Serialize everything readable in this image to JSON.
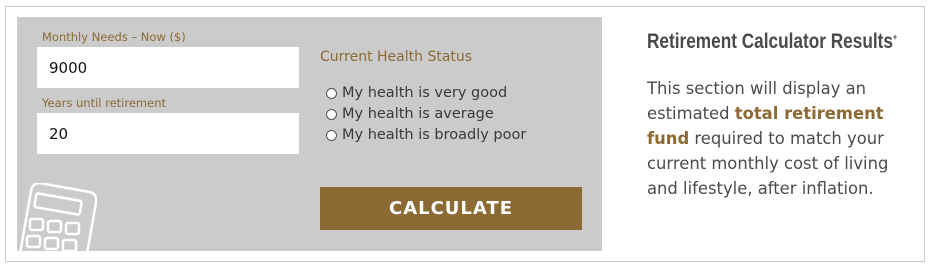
{
  "form": {
    "monthly_needs_label": "Monthly Needs – Now ($)",
    "monthly_needs_value": "9000",
    "years_label": "Years until retirement",
    "years_value": "20",
    "health_title": "Current Health Status",
    "health_options": [
      "My health is very good",
      "My health is average",
      "My health is broadly poor"
    ],
    "calculate_label": "CALCULATE"
  },
  "results": {
    "title": "Retirement Calculator Results",
    "title_mark": "+",
    "text_before": "This section will display an estimated ",
    "text_highlight": "total retirement fund",
    "text_after": " required to match your current monthly cost of living and lifestyle, after inflation."
  },
  "colors": {
    "accent": "#8b6a34",
    "panel_bg": "#cbcbcb"
  },
  "icons": {
    "background_icon": "calculator-icon"
  }
}
